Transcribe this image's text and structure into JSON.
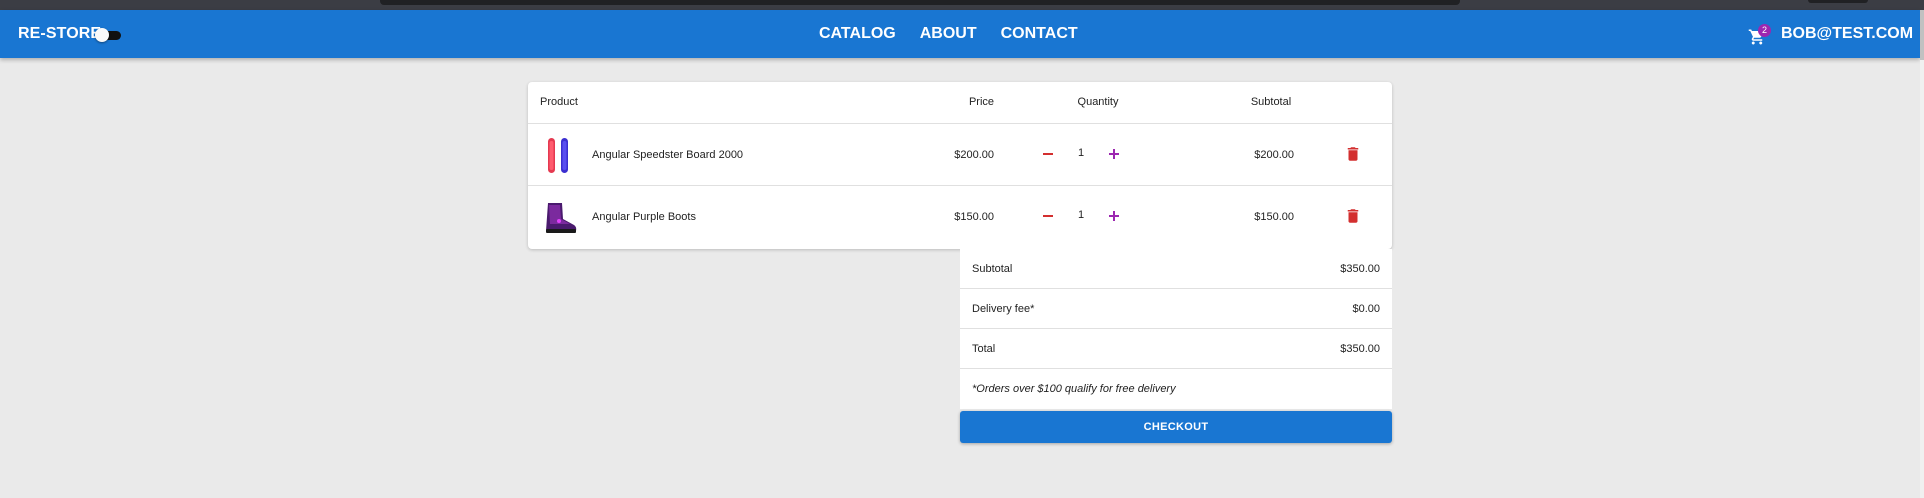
{
  "colors": {
    "appbar": "#1976d2",
    "background": "#eaeaea",
    "badge": "#9c27b0",
    "minus": "#d32f2f",
    "plus": "#9c27b0",
    "trash": "#d32f2f",
    "checkout": "#1976d2"
  },
  "header": {
    "brand": "RE-STORE",
    "dark_mode_toggle": {
      "icon": "toggle-switch",
      "on": false
    },
    "nav": [
      "CATALOG",
      "ABOUT",
      "CONTACT"
    ],
    "cart": {
      "icon": "shopping-cart-icon",
      "badge_count": "2"
    },
    "user": "BOB@TEST.COM"
  },
  "cart_table": {
    "headers": {
      "product": "Product",
      "price": "Price",
      "quantity": "Quantity",
      "subtotal": "Subtotal"
    },
    "rows": [
      {
        "image_icon": "snowboard-icon",
        "name": "Angular Speedster Board 2000",
        "price": "$200.00",
        "quantity": "1",
        "subtotal": "$200.00"
      },
      {
        "image_icon": "boot-icon",
        "name": "Angular Purple Boots",
        "price": "$150.00",
        "quantity": "1",
        "subtotal": "$150.00"
      }
    ]
  },
  "summary": {
    "subtotal_label": "Subtotal",
    "subtotal_value": "$350.00",
    "delivery_label": "Delivery fee*",
    "delivery_value": "$0.00",
    "total_label": "Total",
    "total_value": "$350.00",
    "note": "*Orders over $100 qualify for free delivery"
  },
  "checkout_label": "CHECKOUT"
}
